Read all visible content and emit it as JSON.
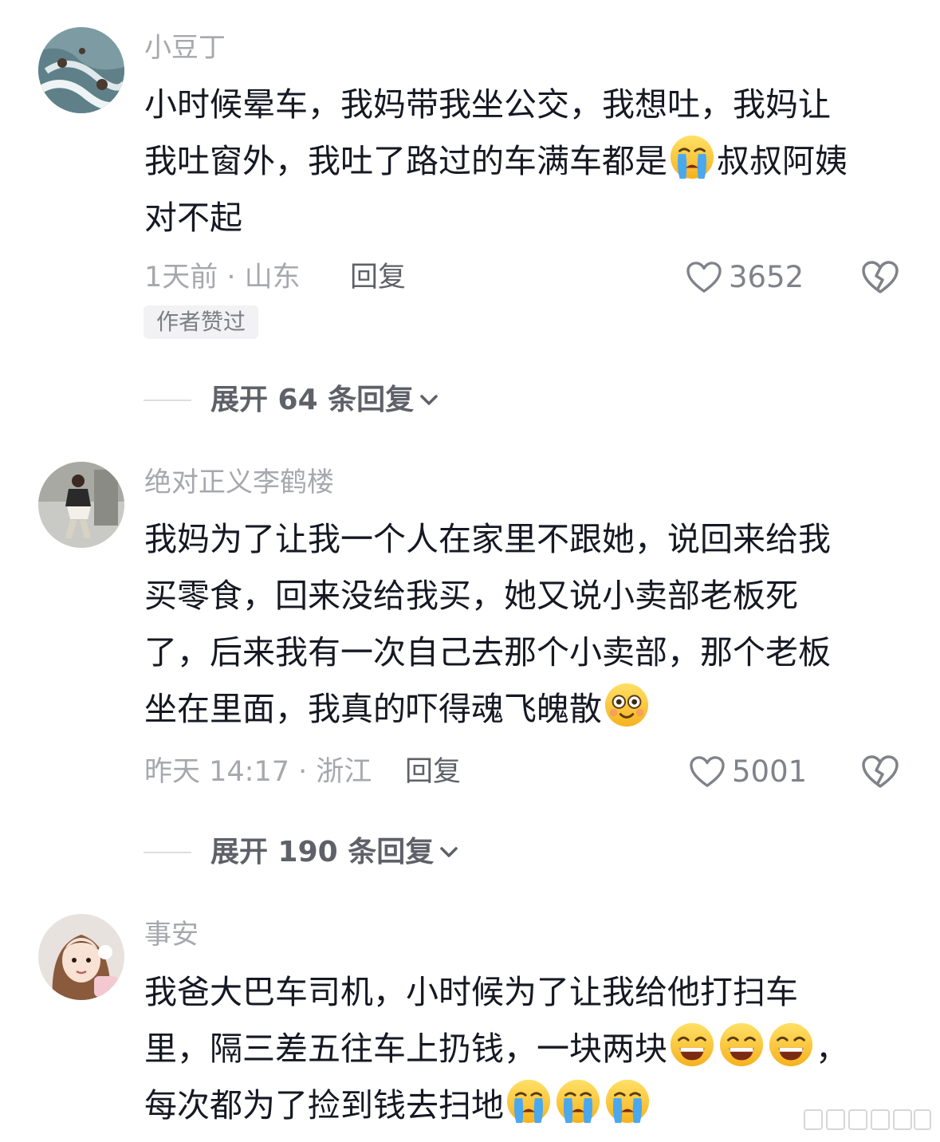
{
  "comments": [
    {
      "username": "小豆丁",
      "lines": [
        "小时候晕车，我妈带我坐公交，我想吐，我妈让",
        "我吐窗外，我吐了路过的车满车都是",
        "叔叔阿姨",
        "对不起"
      ],
      "meta": "1天前 · 山东",
      "reply_label": "回复",
      "likes": "3652",
      "author_tag": "作者赞过",
      "expand_label": "展开 64 条回复"
    },
    {
      "username": "绝对正义李鹤楼",
      "lines": [
        "我妈为了让我一个人在家里不跟她，说回来给我",
        "买零食，回来没给我买，她又说小卖部老板死",
        "了，后来我有一次自己去那个小卖部，那个老板",
        "坐在里面，我真的吓得魂飞魄散"
      ],
      "meta": "昨天 14:17 · 浙江",
      "reply_label": "回复",
      "likes": "5001",
      "expand_label": "展开 190 条回复"
    },
    {
      "username": "事安",
      "lines": [
        "我爸大巴车司机，小时候为了让我给他打扫车",
        "里，隔三差五往车上扔钱，一块两块",
        "，",
        "每次都为了捡到钱去扫地"
      ]
    }
  ],
  "icons": {
    "like": "heart-outline-icon",
    "dislike": "broken-heart-icon",
    "expand": "chevron-down-icon",
    "emoji_cry": "loudly-crying-emoji",
    "emoji_dazed": "dazed-emoji",
    "emoji_grin": "grinning-emoji"
  },
  "colors": {
    "username": "#a6a8ad",
    "body": "#161823",
    "meta": "#a6a8ad",
    "action": "#5f6169"
  }
}
